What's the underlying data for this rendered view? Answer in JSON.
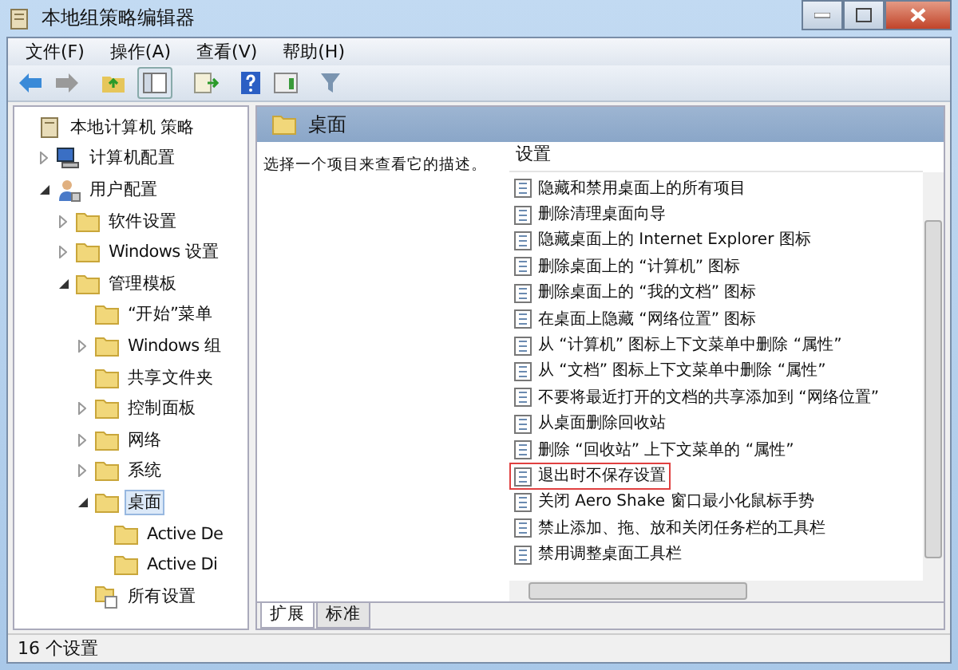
{
  "window": {
    "title": "本地组策略编辑器"
  },
  "menu": [
    "文件(F)",
    "操作(A)",
    "查看(V)",
    "帮助(H)"
  ],
  "toolbar": [
    {
      "kind": "back"
    },
    {
      "kind": "forward"
    },
    {
      "kind": "up"
    },
    {
      "kind": "tree"
    },
    {
      "kind": "export"
    },
    {
      "kind": "help"
    },
    {
      "kind": "pane"
    },
    {
      "kind": "filter"
    }
  ],
  "tree": [
    {
      "label": "本地计算机 策略",
      "kind": "policy",
      "selected": false,
      "children": [
        {
          "label": "计算机配置",
          "kind": "computer",
          "expanded": false,
          "selected": false
        },
        {
          "label": "用户配置",
          "kind": "user",
          "expanded": true,
          "selected": false,
          "children": [
            {
              "label": "软件设置",
              "kind": "folder",
              "expanded": false,
              "selected": false
            },
            {
              "label": "Windows 设置",
              "kind": "folder",
              "expanded": false,
              "selected": false
            },
            {
              "label": "管理模板",
              "kind": "folder",
              "expanded": true,
              "selected": false,
              "children": [
                {
                  "label": "“开始”菜单",
                  "kind": "folder",
                  "selected": false
                },
                {
                  "label": "Windows 组",
                  "kind": "folder",
                  "expanded": false,
                  "selected": false
                },
                {
                  "label": "共享文件夹",
                  "kind": "folder",
                  "selected": false
                },
                {
                  "label": "控制面板",
                  "kind": "folder",
                  "expanded": false,
                  "selected": false
                },
                {
                  "label": "网络",
                  "kind": "folder",
                  "expanded": false,
                  "selected": false
                },
                {
                  "label": "系统",
                  "kind": "folder",
                  "expanded": false,
                  "selected": false
                },
                {
                  "label": "桌面",
                  "kind": "folder",
                  "expanded": true,
                  "selected": true,
                  "children": [
                    {
                      "label": "Active De",
                      "kind": "folder",
                      "selected": false
                    },
                    {
                      "label": "Active Di",
                      "kind": "folder",
                      "selected": false
                    }
                  ]
                },
                {
                  "label": "所有设置",
                  "kind": "all",
                  "selected": false
                }
              ]
            }
          ]
        }
      ]
    }
  ],
  "header": {
    "title": "桌面"
  },
  "description": "选择一个项目来查看它的描述。",
  "settings": {
    "column": "设置",
    "rows": [
      {
        "label": "隐藏和禁用桌面上的所有项目",
        "highlighted": false
      },
      {
        "label": "删除清理桌面向导",
        "highlighted": false
      },
      {
        "label": "隐藏桌面上的 Internet Explorer 图标",
        "highlighted": false
      },
      {
        "label": "删除桌面上的 “计算机” 图标",
        "highlighted": false
      },
      {
        "label": "删除桌面上的 “我的文档” 图标",
        "highlighted": false
      },
      {
        "label": "在桌面上隐藏 “网络位置” 图标",
        "highlighted": false
      },
      {
        "label": "从 “计算机” 图标上下文菜单中删除 “属性”",
        "highlighted": false
      },
      {
        "label": "从 “文档” 图标上下文菜单中删除 “属性”",
        "highlighted": false
      },
      {
        "label": "不要将最近打开的文档的共享添加到 “网络位置”",
        "highlighted": false
      },
      {
        "label": "从桌面删除回收站",
        "highlighted": false
      },
      {
        "label": "删除 “回收站” 上下文菜单的 “属性”",
        "highlighted": false
      },
      {
        "label": "退出时不保存设置",
        "highlighted": true
      },
      {
        "label": "关闭 Aero Shake 窗口最小化鼠标手势",
        "highlighted": false
      },
      {
        "label": "禁止添加、拖、放和关闭任务栏的工具栏",
        "highlighted": false
      },
      {
        "label": "禁用调整桌面工具栏",
        "highlighted": false
      }
    ]
  },
  "tabs": [
    {
      "label": "扩展",
      "selected": true
    },
    {
      "label": "标准",
      "selected": false
    }
  ],
  "status_bar": "16 个设置"
}
